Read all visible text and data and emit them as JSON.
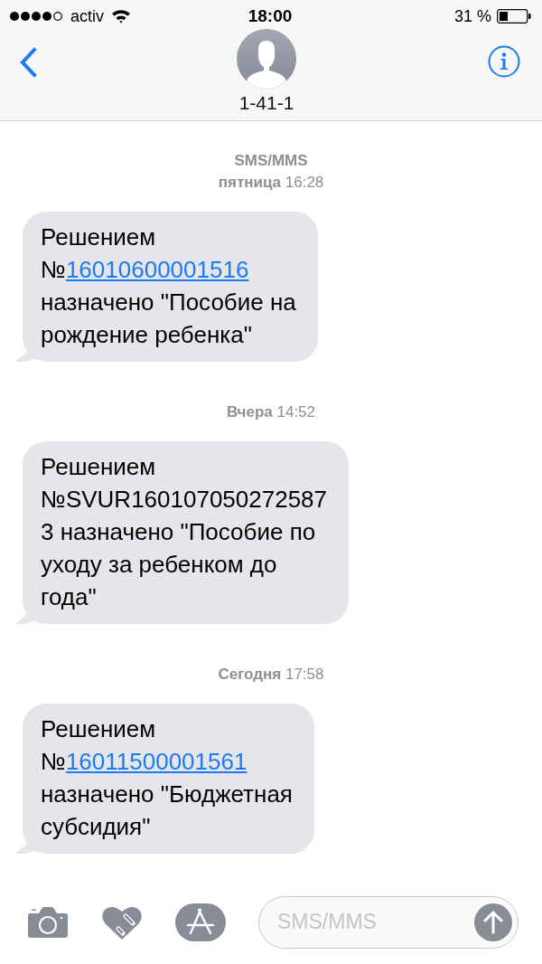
{
  "status_bar": {
    "carrier": "activ",
    "time": "18:00",
    "battery": "31 %"
  },
  "header": {
    "contact": "1-41-1"
  },
  "conversation": [
    {
      "kind": "label",
      "text": "SMS/MMS"
    },
    {
      "kind": "timestamp",
      "text": "**пятница** 16:28"
    },
    {
      "kind": "message",
      "parts": [
        {
          "kind": "text",
          "text": "Решением\n№"
        },
        {
          "kind": "link",
          "text": "16010600001516"
        },
        {
          "kind": "text",
          "text": "\nназначено \"Пособие на\nрождение ребенка\""
        }
      ]
    },
    {
      "kind": "timestamp",
      "text": "**Вчера** 14:52"
    },
    {
      "kind": "message",
      "parts": [
        {
          "kind": "text",
          "text": "Решением\n№SVUR160107050272587\n3 назначено \"Пособие по\nуходу за ребенком до\nгода\""
        }
      ]
    },
    {
      "kind": "timestamp",
      "text": "**Сегодня** 17:58"
    },
    {
      "kind": "message",
      "parts": [
        {
          "kind": "text",
          "text": "Решением\n№"
        },
        {
          "kind": "link",
          "text": "16011500001561"
        },
        {
          "kind": "text",
          "text": "\nназначено \"Бюджетная\nсубсидия\""
        }
      ]
    }
  ],
  "composer": {
    "placeholder": "SMS/MMS"
  }
}
